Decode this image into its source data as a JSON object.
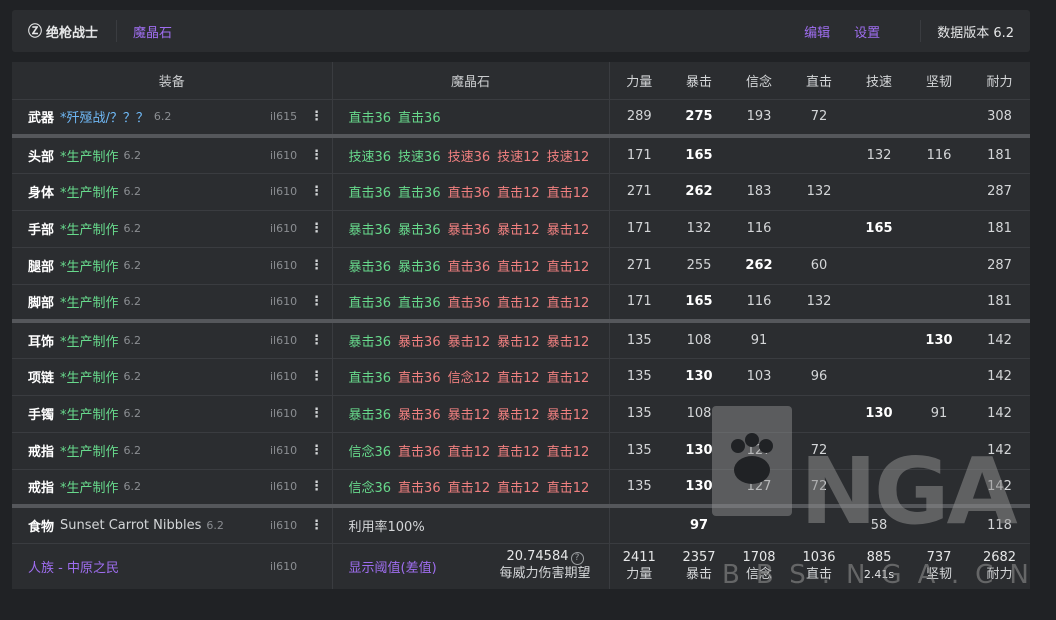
{
  "header": {
    "job_icon": "Ⓩ",
    "job_name": "绝枪战士",
    "materia_tab": "魔晶石",
    "edit": "编辑",
    "settings": "设置",
    "version": "数据版本 6.2"
  },
  "columns": [
    "装备",
    "魔晶石",
    "力量",
    "暴击",
    "信念",
    "直击",
    "技速",
    "坚韧",
    "耐力"
  ],
  "rows": [
    {
      "slot": "武器",
      "name": "*歼殛战/？？？",
      "name_style": "blue",
      "ver": "6.2",
      "ilvl": "il615",
      "materia": [
        {
          "t": "直击36",
          "c": "green"
        },
        {
          "t": "直击36",
          "c": "green"
        }
      ],
      "stats": [
        "289",
        "275",
        "193",
        "72",
        "",
        "",
        "308"
      ],
      "bold": 1,
      "gap": true
    },
    {
      "slot": "头部",
      "name": "*生产制作",
      "name_style": "craft",
      "ver": "6.2",
      "ilvl": "il610",
      "materia": [
        {
          "t": "技速36",
          "c": "green"
        },
        {
          "t": "技速36",
          "c": "green"
        },
        {
          "t": "技速36",
          "c": "red"
        },
        {
          "t": "技速12",
          "c": "red"
        },
        {
          "t": "技速12",
          "c": "red"
        }
      ],
      "stats": [
        "171",
        "165",
        "",
        "",
        "132",
        "116",
        "181"
      ],
      "bold": 1
    },
    {
      "slot": "身体",
      "name": "*生产制作",
      "name_style": "craft",
      "ver": "6.2",
      "ilvl": "il610",
      "materia": [
        {
          "t": "直击36",
          "c": "green"
        },
        {
          "t": "直击36",
          "c": "green"
        },
        {
          "t": "直击36",
          "c": "red"
        },
        {
          "t": "直击12",
          "c": "red"
        },
        {
          "t": "直击12",
          "c": "red"
        }
      ],
      "stats": [
        "271",
        "262",
        "183",
        "132",
        "",
        "",
        "287"
      ],
      "bold": 1
    },
    {
      "slot": "手部",
      "name": "*生产制作",
      "name_style": "craft",
      "ver": "6.2",
      "ilvl": "il610",
      "materia": [
        {
          "t": "暴击36",
          "c": "green"
        },
        {
          "t": "暴击36",
          "c": "green"
        },
        {
          "t": "暴击36",
          "c": "red"
        },
        {
          "t": "暴击12",
          "c": "red"
        },
        {
          "t": "暴击12",
          "c": "red"
        }
      ],
      "stats": [
        "171",
        "132",
        "116",
        "",
        "165",
        "",
        "181"
      ],
      "bold": 4
    },
    {
      "slot": "腿部",
      "name": "*生产制作",
      "name_style": "craft",
      "ver": "6.2",
      "ilvl": "il610",
      "materia": [
        {
          "t": "暴击36",
          "c": "green"
        },
        {
          "t": "暴击36",
          "c": "green"
        },
        {
          "t": "直击36",
          "c": "red"
        },
        {
          "t": "直击12",
          "c": "red"
        },
        {
          "t": "直击12",
          "c": "red"
        }
      ],
      "stats": [
        "271",
        "255",
        "262",
        "60",
        "",
        "",
        "287"
      ],
      "bold": 2
    },
    {
      "slot": "脚部",
      "name": "*生产制作",
      "name_style": "craft",
      "ver": "6.2",
      "ilvl": "il610",
      "materia": [
        {
          "t": "直击36",
          "c": "green"
        },
        {
          "t": "直击36",
          "c": "green"
        },
        {
          "t": "直击36",
          "c": "red"
        },
        {
          "t": "直击12",
          "c": "red"
        },
        {
          "t": "直击12",
          "c": "red"
        }
      ],
      "stats": [
        "171",
        "165",
        "116",
        "132",
        "",
        "",
        "181"
      ],
      "bold": 1,
      "gap": true
    },
    {
      "slot": "耳饰",
      "name": "*生产制作",
      "name_style": "craft",
      "ver": "6.2",
      "ilvl": "il610",
      "materia": [
        {
          "t": "暴击36",
          "c": "green"
        },
        {
          "t": "暴击36",
          "c": "red"
        },
        {
          "t": "暴击12",
          "c": "red"
        },
        {
          "t": "暴击12",
          "c": "red"
        },
        {
          "t": "暴击12",
          "c": "red"
        }
      ],
      "stats": [
        "135",
        "108",
        "91",
        "",
        "",
        "130",
        "142"
      ],
      "bold": 5
    },
    {
      "slot": "项链",
      "name": "*生产制作",
      "name_style": "craft",
      "ver": "6.2",
      "ilvl": "il610",
      "materia": [
        {
          "t": "直击36",
          "c": "green"
        },
        {
          "t": "直击36",
          "c": "red"
        },
        {
          "t": "信念12",
          "c": "red"
        },
        {
          "t": "直击12",
          "c": "red"
        },
        {
          "t": "直击12",
          "c": "red"
        }
      ],
      "stats": [
        "135",
        "130",
        "103",
        "96",
        "",
        "",
        "142"
      ],
      "bold": 1
    },
    {
      "slot": "手镯",
      "name": "*生产制作",
      "name_style": "craft",
      "ver": "6.2",
      "ilvl": "il610",
      "materia": [
        {
          "t": "暴击36",
          "c": "green"
        },
        {
          "t": "暴击36",
          "c": "red"
        },
        {
          "t": "暴击12",
          "c": "red"
        },
        {
          "t": "暴击12",
          "c": "red"
        },
        {
          "t": "暴击12",
          "c": "red"
        }
      ],
      "stats": [
        "135",
        "108",
        "",
        "",
        "130",
        "91",
        "142"
      ],
      "bold": 4
    },
    {
      "slot": "戒指",
      "name": "*生产制作",
      "name_style": "craft",
      "ver": "6.2",
      "ilvl": "il610",
      "materia": [
        {
          "t": "信念36",
          "c": "green"
        },
        {
          "t": "直击36",
          "c": "red"
        },
        {
          "t": "直击12",
          "c": "red"
        },
        {
          "t": "直击12",
          "c": "red"
        },
        {
          "t": "直击12",
          "c": "red"
        }
      ],
      "stats": [
        "135",
        "130",
        "127",
        "72",
        "",
        "",
        "142"
      ],
      "bold": 1
    },
    {
      "slot": "戒指",
      "name": "*生产制作",
      "name_style": "craft",
      "ver": "6.2",
      "ilvl": "il610",
      "materia": [
        {
          "t": "信念36",
          "c": "green"
        },
        {
          "t": "直击36",
          "c": "red"
        },
        {
          "t": "直击12",
          "c": "red"
        },
        {
          "t": "直击12",
          "c": "red"
        },
        {
          "t": "直击12",
          "c": "red"
        }
      ],
      "stats": [
        "135",
        "130",
        "127",
        "72",
        "",
        "",
        "142"
      ],
      "bold": 1,
      "gap": true
    },
    {
      "slot": "食物",
      "name": "Sunset Carrot Nibbles",
      "name_style": "plain",
      "ver": "6.2",
      "ilvl": "il610",
      "materia": [
        {
          "t": "利用率100%",
          "c": "white"
        }
      ],
      "stats": [
        "",
        "97",
        "",
        "",
        "58",
        "",
        "118"
      ],
      "bold": 1
    }
  ],
  "footer": {
    "race": "人族 - 中原之民",
    "ilvl": "il610",
    "show_threshold": "显示阈值(差值)",
    "damage_value": "20.74584",
    "damage_help": "?",
    "damage_label": "每威力伤害期望",
    "totals": [
      {
        "v": "2411",
        "l": "力量"
      },
      {
        "v": "2357",
        "l": "暴击"
      },
      {
        "v": "1708",
        "l": "信念"
      },
      {
        "v": "1036",
        "l": "直击"
      },
      {
        "v": "885",
        "l": "2.41s"
      },
      {
        "v": "737",
        "l": "坚韧"
      },
      {
        "v": "2682",
        "l": "耐力"
      }
    ]
  },
  "watermark": {
    "logo": "NGA",
    "site": "BBS.NGA.CN"
  },
  "colors": {
    "purple": "#9f6ef0",
    "green": "#67d98c",
    "red": "#f08080",
    "blue": "#6fb8f5",
    "panel": "#2b2d30",
    "bg": "#202225"
  }
}
